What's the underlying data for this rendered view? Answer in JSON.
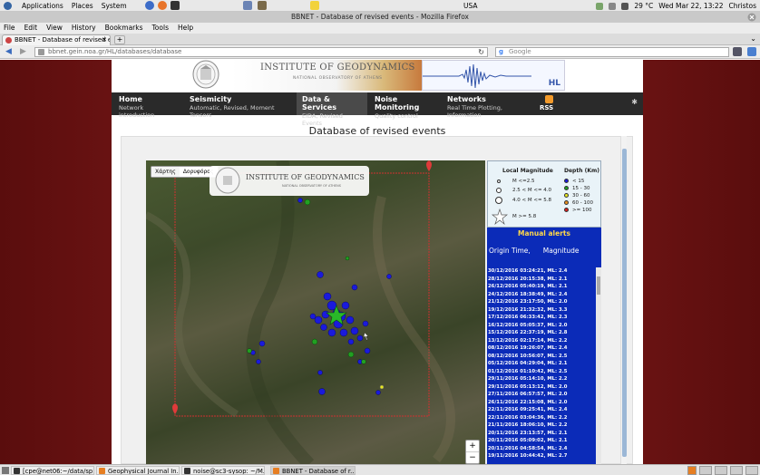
{
  "topbar": {
    "apps": "Applications",
    "places": "Places",
    "system": "System",
    "keyboard": "USA",
    "temperature": "29 °C",
    "clock": "Wed Mar 22, 13:22",
    "user": "Christos"
  },
  "window": {
    "title": "BBNET - Database of revised events - Mozilla Firefox"
  },
  "menubar": [
    "File",
    "Edit",
    "View",
    "History",
    "Bookmarks",
    "Tools",
    "Help"
  ],
  "tab": {
    "label": "BBNET - Database of revised eve..."
  },
  "navbar": {
    "url": "bbnet.gein.noa.gr/HL/databases/database",
    "search_placeholder": "Google"
  },
  "header": {
    "institute": "INSTITUTE OF GEODYNAMICS",
    "institute_sub": "NATIONAL OBSERVATORY OF ATHENS",
    "seismo_label": "HL"
  },
  "mainnav": [
    {
      "title": "Home",
      "sub": "Network introduction"
    },
    {
      "title": "Seismicity",
      "sub": "Automatic, Revised, Moment Tensors"
    },
    {
      "title": "Data & Services",
      "sub": "EIDA, Revised Events"
    },
    {
      "title": "Noise Monitoring",
      "sub": "Quality control"
    },
    {
      "title": "Networks",
      "sub": "Real Time Plotting, Information"
    }
  ],
  "rss_label": "RSS",
  "page_title": "Database of revised events",
  "map": {
    "toggle_map": "Χάρτης",
    "toggle_sat": "Δορυφόρος",
    "zoom_in": "+",
    "zoom_out": "−"
  },
  "legend": {
    "mag_title": "Local Magnitude",
    "depth_title": "Depth (Km)",
    "mag": [
      "M <=2.5",
      "2.5 < M <= 4.0",
      "4.0 < M <= 5.8",
      "M >= 5.8"
    ],
    "depth": [
      "< 15",
      "15 - 30",
      "30 - 60",
      "60 - 100",
      ">= 100"
    ],
    "depth_colors": [
      "#1a1adc",
      "#22a022",
      "#e8e820",
      "#e89020",
      "#d82020"
    ]
  },
  "alerts": {
    "heading": "Manual alerts",
    "col_time": "Origin Time,",
    "col_mag": "Magnitude",
    "rows": [
      "30/12/2016 03:24:21, ML: 2.4",
      "28/12/2016 20:15:38, ML: 2.1",
      "26/12/2016 05:40:19, ML: 2.1",
      "24/12/2016 18:38:49, ML: 2.4",
      "21/12/2016 23:17:50, ML: 2.0",
      "19/12/2016 21:32:32, ML: 3.3",
      "17/12/2016 06:33:42, ML: 2.3",
      "16/12/2016 05:05:37, ML: 2.0",
      "15/12/2016 22:37:19, ML: 2.8",
      "13/12/2016 02:17:14, ML: 2.2",
      "08/12/2016 19:26:07, ML: 2.4",
      "08/12/2016 10:56:07, ML: 2.5",
      "05/12/2016 04:29:04, ML: 2.1",
      "01/12/2016 01:10:42, ML: 2.5",
      "29/11/2016 05:14:10, ML: 2.2",
      "29/11/2016 05:13:12, ML: 2.0",
      "27/11/2016 06:57:57, ML: 2.0",
      "26/11/2016 22:15:08, ML: 2.0",
      "22/11/2016 09:25:41, ML: 2.4",
      "22/11/2016 03:04:36, ML: 2.2",
      "21/11/2016 18:06:10, ML: 2.2",
      "20/11/2016 23:13:57, ML: 2.1",
      "20/11/2016 05:09:02, ML: 2.1",
      "20/11/2016 04:58:54, ML: 2.4",
      "19/11/2016 10:44:42, ML: 2.7"
    ]
  },
  "taskbar": [
    {
      "label": "[cpe@net06:~/data/sp...",
      "color": "#333333"
    },
    {
      "label": "Geophysical Journal In...",
      "color": "#e67e22"
    },
    {
      "label": "noise@sc3-sysop: ~/M...",
      "color": "#333333"
    },
    {
      "label": "BBNET - Database of r...",
      "color": "#e67e22"
    }
  ]
}
